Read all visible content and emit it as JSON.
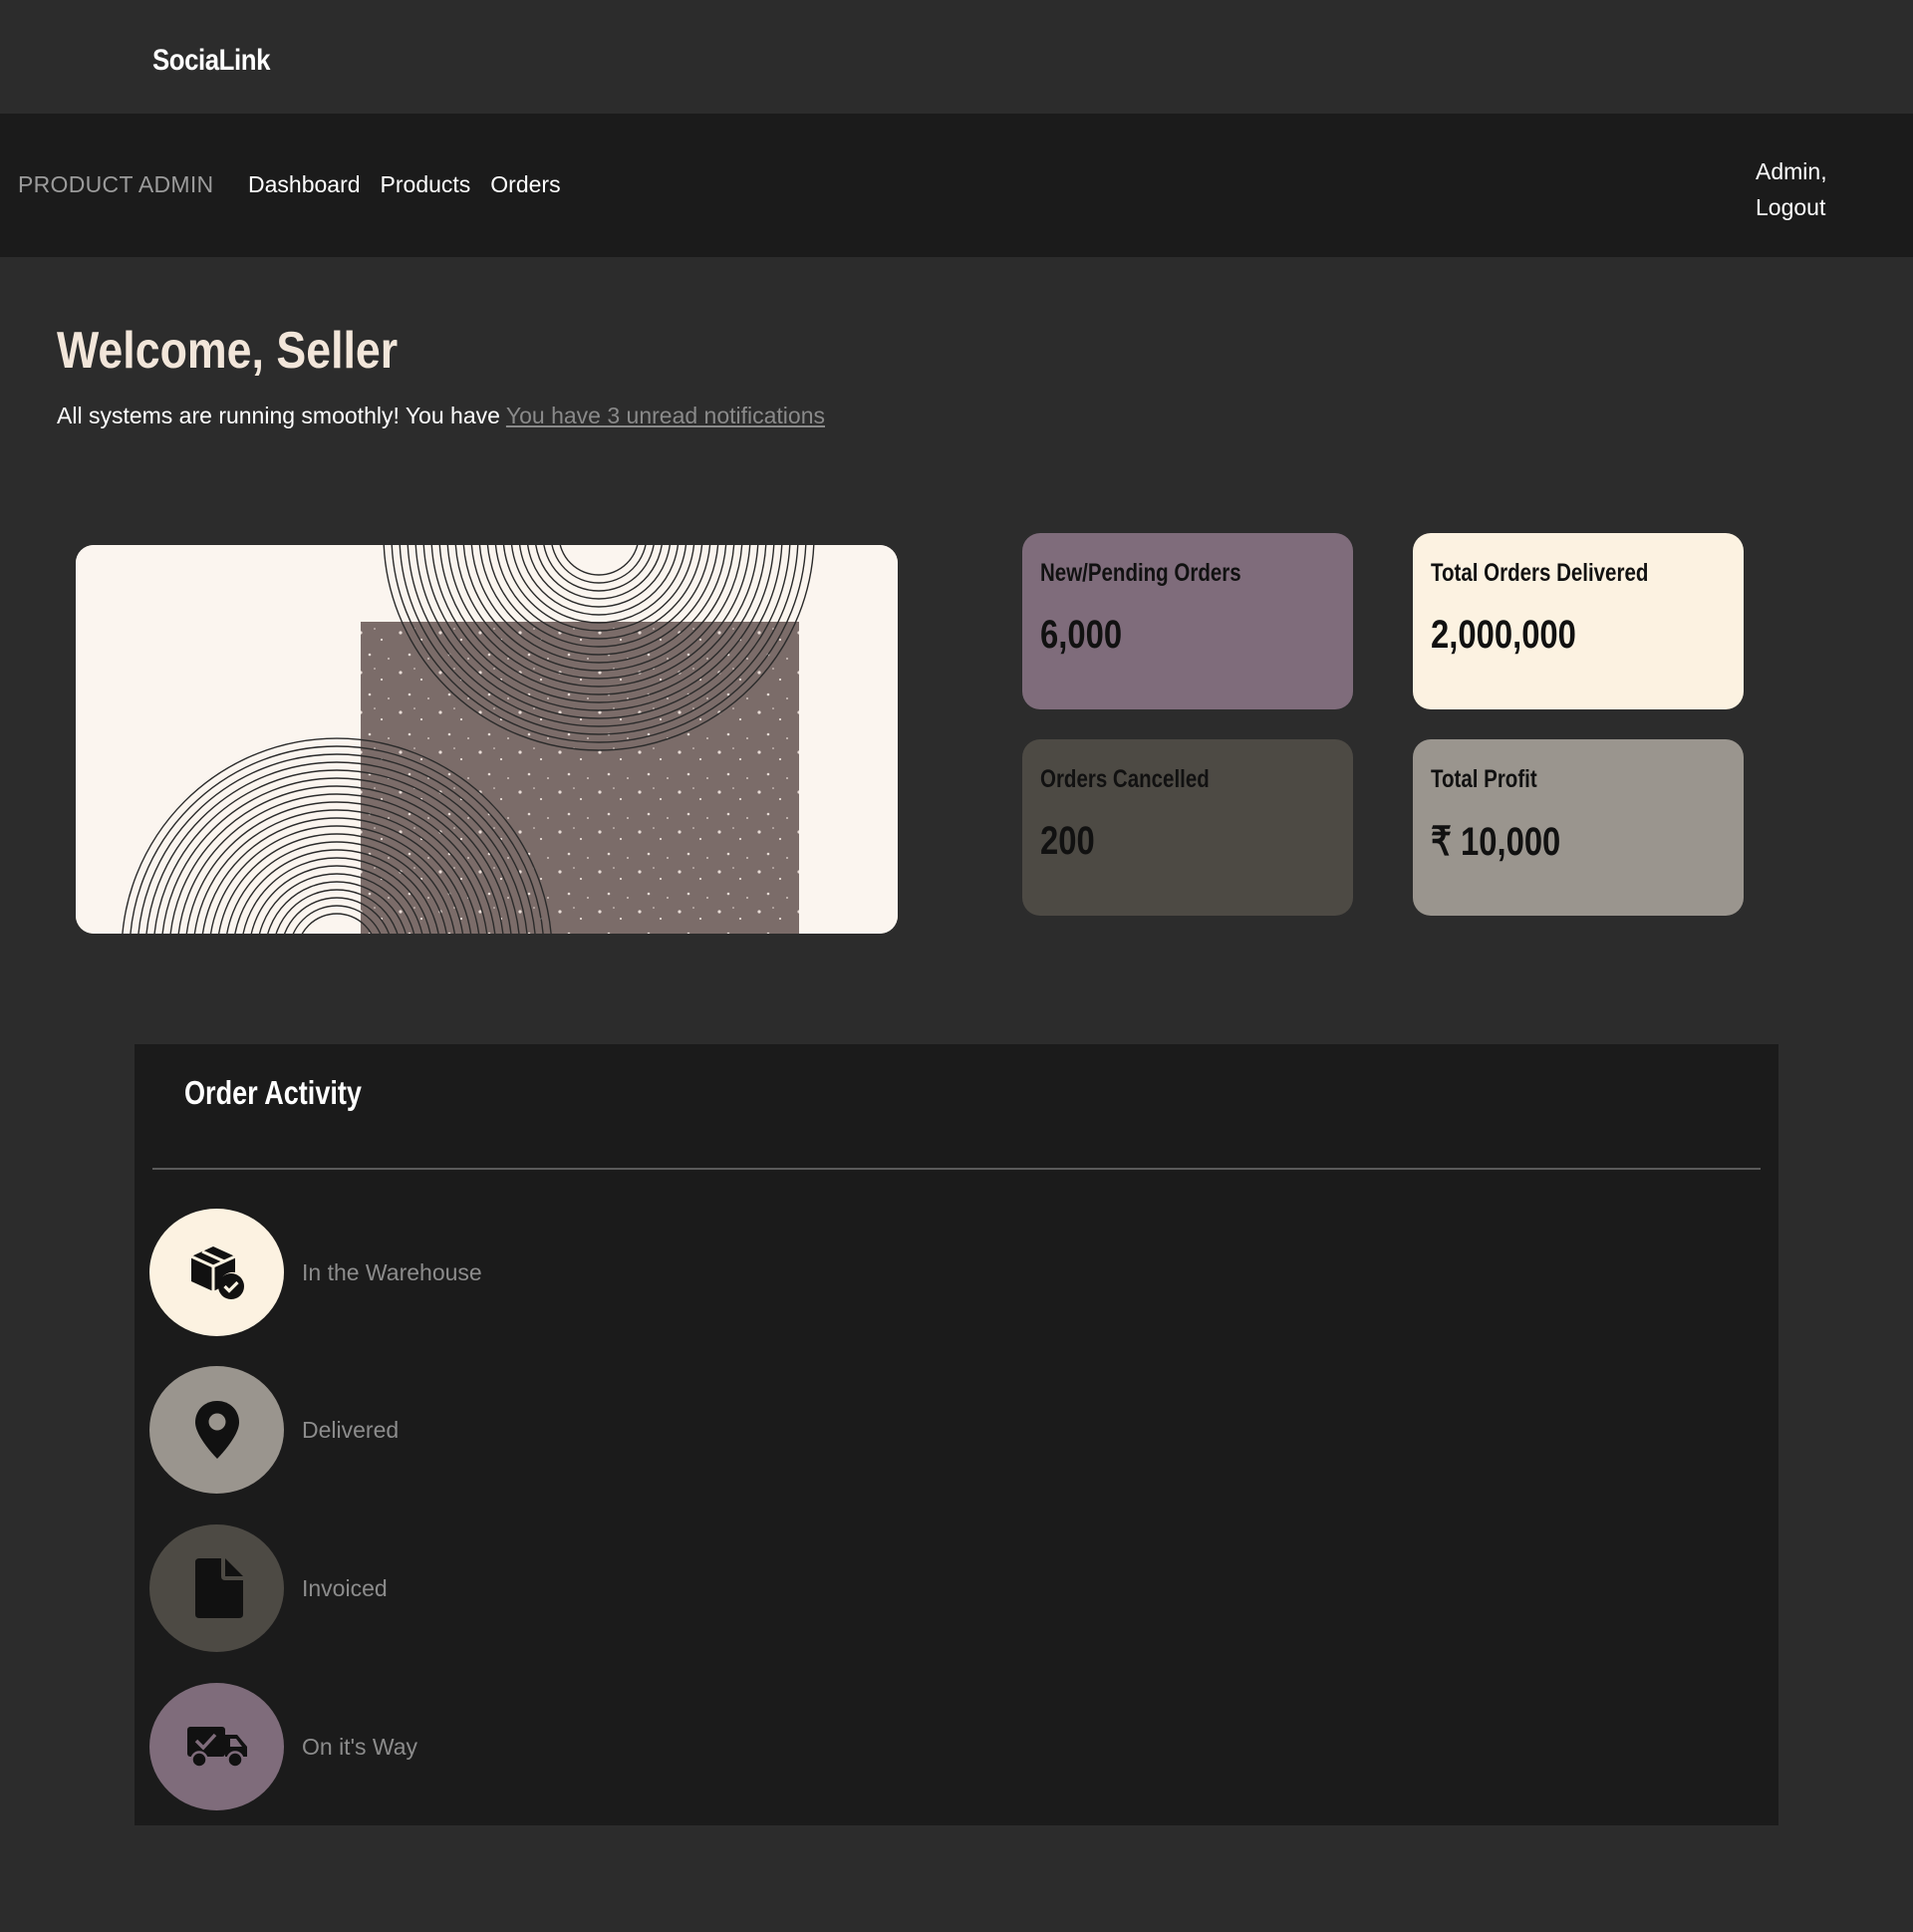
{
  "brand": "SociaLink",
  "nav": {
    "brand": "PRODUCT ADMIN",
    "links": [
      "Dashboard",
      "Products",
      "Orders"
    ],
    "user_greeting": "Admin,",
    "logout": "Logout"
  },
  "welcome": {
    "title": "Welcome, Seller",
    "message": "All systems are running smoothly! You have ",
    "notifications_link": "You have 3 unread notifications"
  },
  "stats": [
    {
      "label": "New/Pending Orders",
      "value": "6,000",
      "color": "#7f6c7b"
    },
    {
      "label": "Total Orders Delivered",
      "value": "2,000,000",
      "color": "#fcf2e1"
    },
    {
      "label": "Orders Cancelled",
      "value": "200",
      "color": "#4d4a44"
    },
    {
      "label": "Total Profit",
      "value": "₹ 10,000",
      "color": "#9a958e"
    }
  ],
  "activity": {
    "title": "Order Activity",
    "items": [
      {
        "label": "In the Warehouse",
        "icon": "box-check-icon",
        "color": "#fcf2e1"
      },
      {
        "label": "Delivered",
        "icon": "map-pin-icon",
        "color": "#9a958e"
      },
      {
        "label": "Invoiced",
        "icon": "document-icon",
        "color": "#4d4a44"
      },
      {
        "label": "On it's Way",
        "icon": "truck-icon",
        "color": "#7f6c7b"
      }
    ]
  }
}
